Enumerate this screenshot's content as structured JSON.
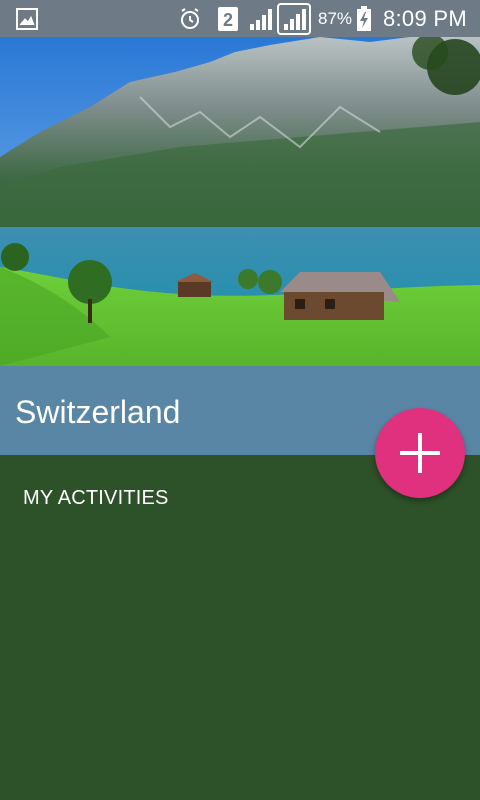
{
  "status_bar": {
    "time": "8:09 PM",
    "battery_percent": "87%",
    "sim_slot": "2",
    "icons": [
      "gallery-notification-icon",
      "alarm-icon",
      "sim-2-icon",
      "signal-1-icon",
      "signal-2-icon",
      "battery-charging-icon"
    ]
  },
  "hero": {
    "image_description": "mountain lake landscape"
  },
  "place": {
    "title": "Switzerland"
  },
  "fab": {
    "icon": "plus-icon",
    "color": "#e0317f"
  },
  "activities": {
    "header": "MY ACTIVITIES"
  },
  "colors": {
    "status_bar": "#6e7b87",
    "title_band": "#5a86a5",
    "background": "#2d5128",
    "accent": "#e0317f"
  }
}
